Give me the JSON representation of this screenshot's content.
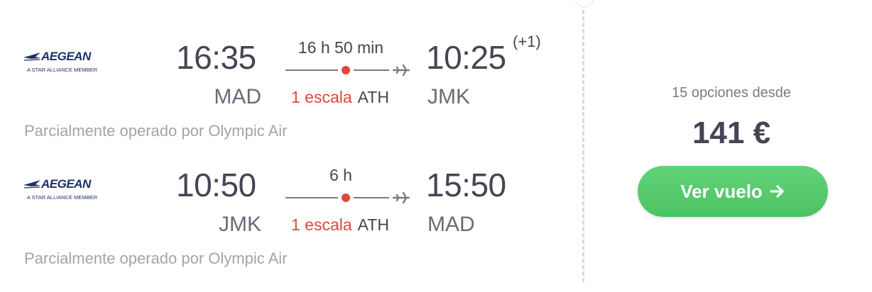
{
  "airline": {
    "name": "AEGEAN",
    "tagline": "A STAR ALLIANCE MEMBER"
  },
  "legs": [
    {
      "departure_time": "16:35",
      "arrival_time": "10:25",
      "day_offset": "(+1)",
      "origin": "MAD",
      "destination": "JMK",
      "duration": "16 h 50 min",
      "stops_label": "1 escala",
      "stop_airport": "ATH",
      "operated_by": "Parcialmente operado por Olympic Air"
    },
    {
      "departure_time": "10:50",
      "arrival_time": "15:50",
      "origin": "JMK",
      "destination": "MAD",
      "duration": "6 h",
      "stops_label": "1 escala",
      "stop_airport": "ATH",
      "operated_by": "Parcialmente operado por Olympic Air"
    }
  ],
  "offer": {
    "options_text": "15 opciones desde",
    "price": "141 €",
    "cta_label": "Ver vuelo"
  },
  "icons": {
    "plane": "plane-icon",
    "arrow": "arrow-right-icon",
    "logo": "aegean-logo-icon"
  },
  "colors": {
    "stop_dot": "#e2453c",
    "cta": "#52c76a",
    "text": "#454553",
    "muted": "#a3a3ad"
  }
}
